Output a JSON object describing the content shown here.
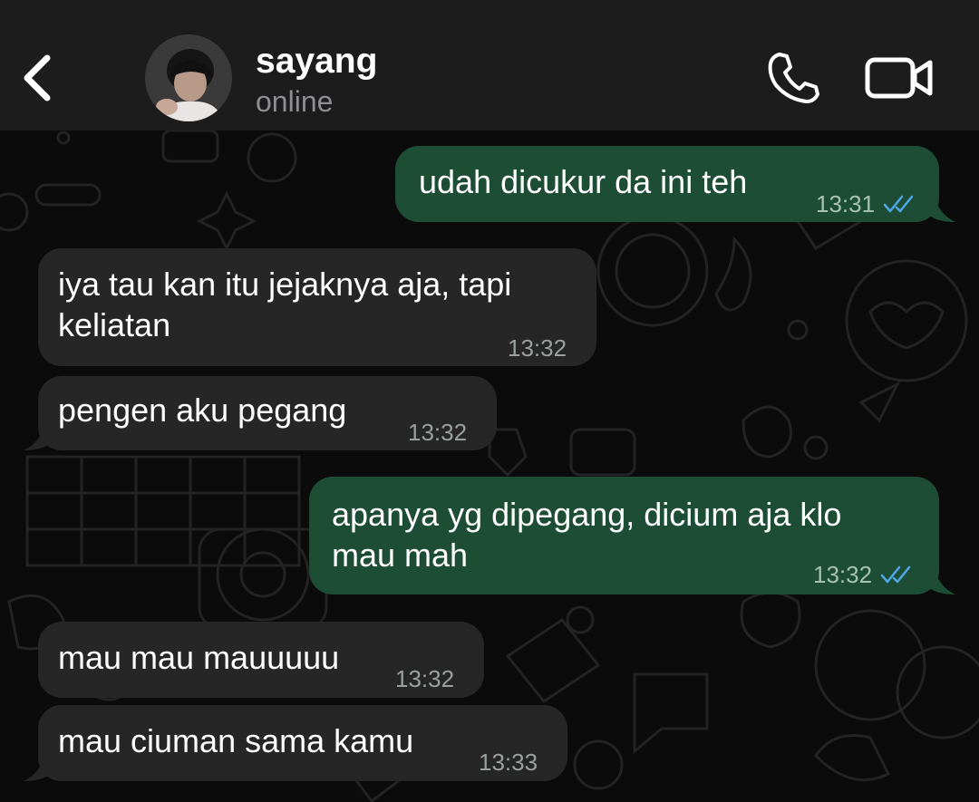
{
  "header": {
    "contact_name": "sayang",
    "status": "online",
    "back_icon": "chevron-left-icon",
    "call_icon": "phone-icon",
    "video_icon": "video-camera-icon"
  },
  "colors": {
    "header_bg": "#1c1c1d",
    "chat_bg": "#0b0b0b",
    "incoming_bubble": "#262626",
    "outgoing_bubble": "#1e4d35",
    "read_tick": "#4fa6e8"
  },
  "messages": [
    {
      "direction": "outgoing",
      "lines": [
        "udah dicukur da ini teh"
      ],
      "time": "13:31",
      "read": true
    },
    {
      "direction": "incoming",
      "lines": [
        "iya tau kan itu jejaknya aja, tapi",
        "keliatan"
      ],
      "time": "13:32"
    },
    {
      "direction": "incoming",
      "lines": [
        "pengen aku pegang"
      ],
      "time": "13:32"
    },
    {
      "direction": "outgoing",
      "lines": [
        "apanya yg dipegang, dicium aja klo",
        "mau mah"
      ],
      "time": "13:32",
      "read": true
    },
    {
      "direction": "incoming",
      "lines": [
        "mau mau mauuuuu"
      ],
      "time": "13:32"
    },
    {
      "direction": "incoming",
      "lines": [
        "mau ciuman sama kamu"
      ],
      "time": "13:33"
    }
  ]
}
